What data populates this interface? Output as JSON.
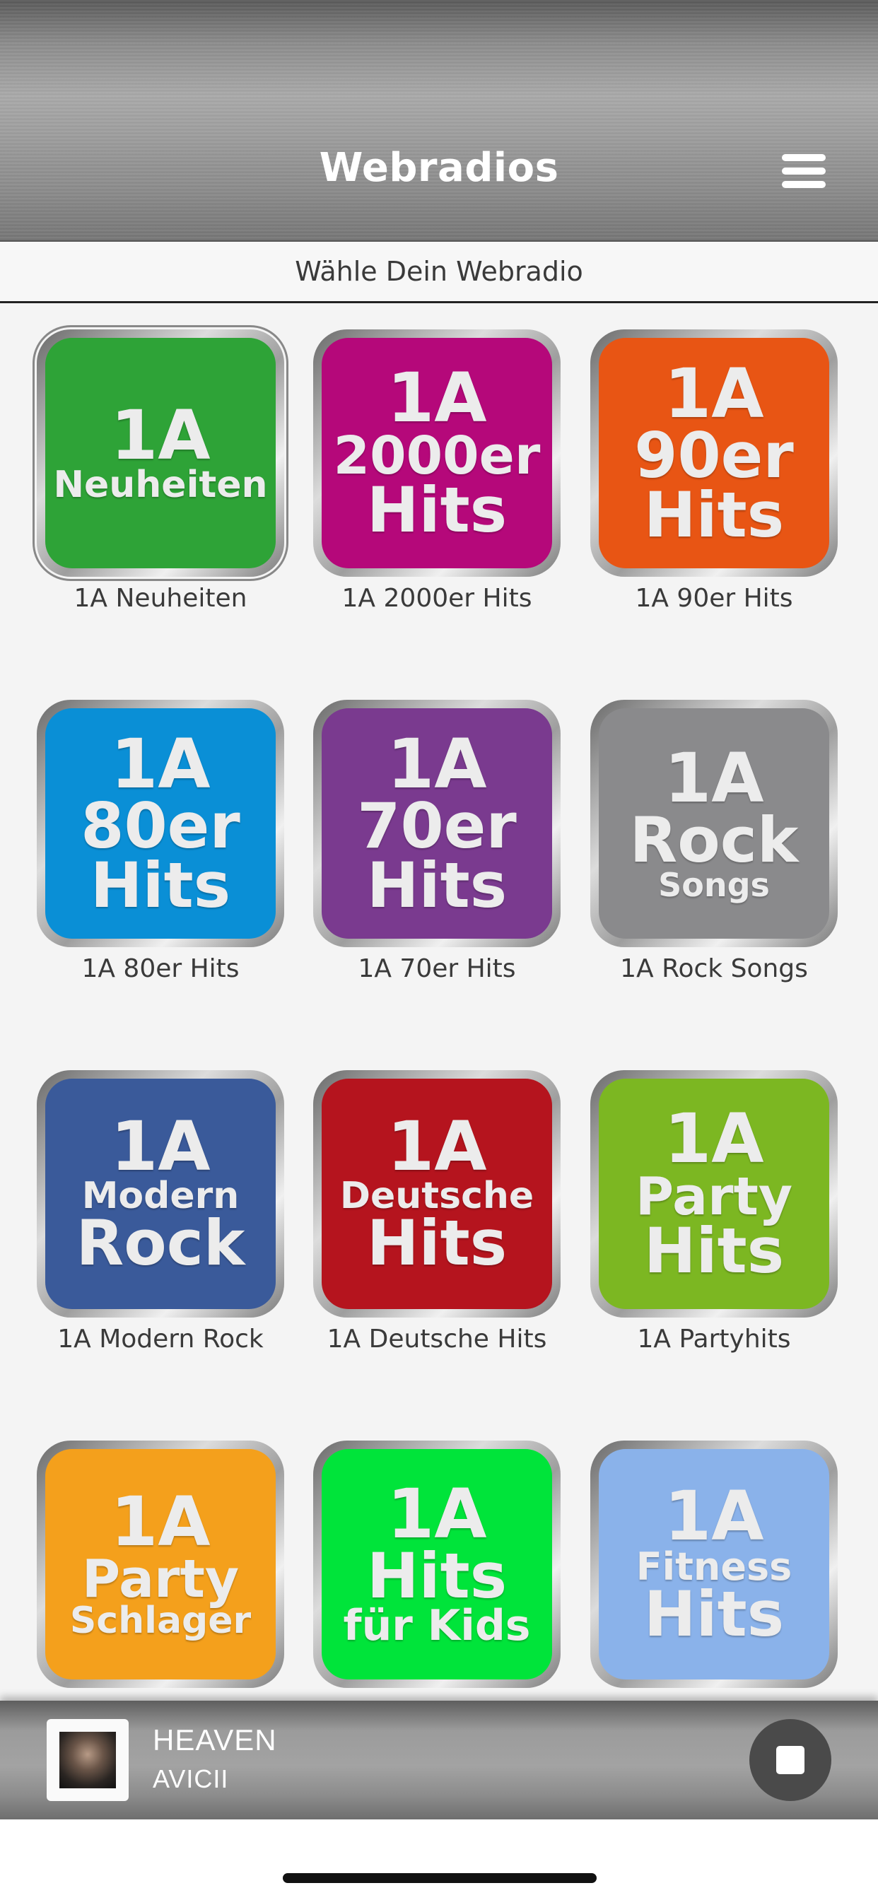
{
  "header": {
    "title": "Webradios",
    "menu_icon": "hamburger-menu-icon"
  },
  "subtitle": "Wähle Dein Webradio",
  "stations": [
    {
      "label": "1A Neuheiten",
      "color": "#2ea337",
      "logo_lines": [
        "1A",
        "Neuheiten"
      ],
      "selected": true
    },
    {
      "label": "1A 2000er Hits",
      "color": "#b5087a",
      "logo_lines": [
        "1A",
        "2000er",
        "Hits"
      ],
      "selected": false
    },
    {
      "label": "1A 90er Hits",
      "color": "#e85514",
      "logo_lines": [
        "1A",
        "90er",
        "Hits"
      ],
      "selected": false
    },
    {
      "label": "1A 80er Hits",
      "color": "#0a8fd6",
      "logo_lines": [
        "1A",
        "80er",
        "Hits"
      ],
      "selected": false
    },
    {
      "label": "1A 70er Hits",
      "color": "#7a3a8f",
      "logo_lines": [
        "1A",
        "70er",
        "Hits"
      ],
      "selected": false
    },
    {
      "label": "1A Rock Songs",
      "color": "#8a8a8c",
      "logo_lines": [
        "1A",
        "Rock",
        "Songs"
      ],
      "selected": false
    },
    {
      "label": "1A Modern Rock",
      "color": "#3a5a9a",
      "logo_lines": [
        "1A",
        "Modern",
        "Rock"
      ],
      "selected": false
    },
    {
      "label": "1A Deutsche Hits",
      "color": "#b5141e",
      "logo_lines": [
        "1A",
        "Deutsche",
        "Hits"
      ],
      "selected": false
    },
    {
      "label": "1A Partyhits",
      "color": "#7cb722",
      "logo_lines": [
        "1A",
        "Party",
        "Hits"
      ],
      "selected": false
    },
    {
      "label": "",
      "color": "#f4a01c",
      "logo_lines": [
        "1A",
        "Party",
        "Schlager"
      ],
      "selected": false
    },
    {
      "label": "",
      "color": "#00e43a",
      "logo_lines": [
        "1A",
        "Hits",
        "für Kids"
      ],
      "selected": false
    },
    {
      "label": "",
      "color": "#8ab2ea",
      "logo_lines": [
        "1A",
        "Fitness",
        "Hits"
      ],
      "selected": false
    }
  ],
  "player": {
    "title": "HEAVEN",
    "artist": "AVICII",
    "cover_icon": "album-cover-icon",
    "stop_icon": "stop-icon"
  }
}
